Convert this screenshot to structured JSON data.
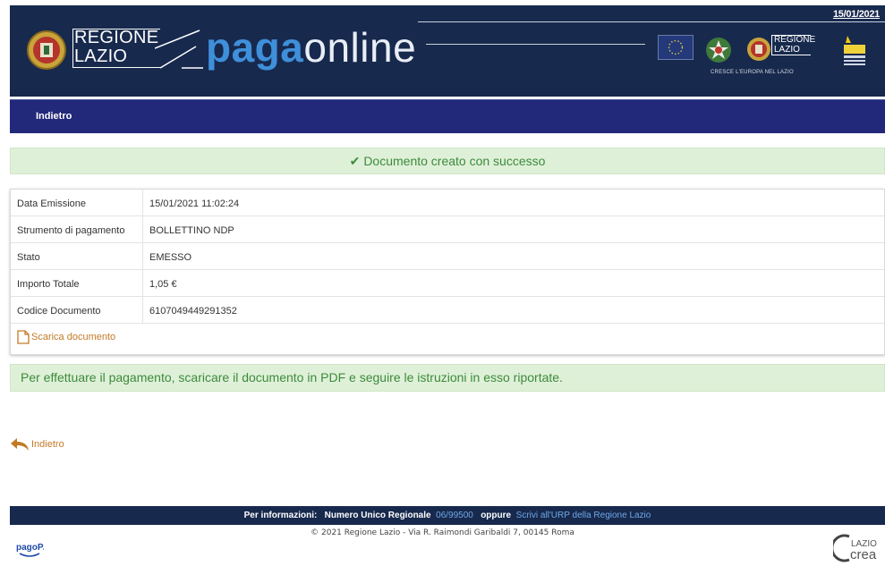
{
  "header": {
    "date": "15/01/2021",
    "regione_line1": "REGIONE",
    "regione_line2": "LAZIO",
    "brand_paga": "paga",
    "brand_online": "online",
    "small_regione_line1": "REGIONE",
    "small_regione_line2": "LAZIO",
    "cresce": "CRESCE L'EUROPA NEL LAZIO"
  },
  "nav": {
    "back_label": "Indietro"
  },
  "success_alert": {
    "icon": "checkmark-icon",
    "message": "Documento creato con successo"
  },
  "details": {
    "rows": [
      {
        "label": "Data Emissione",
        "value": "15/01/2021 11:02:24"
      },
      {
        "label": "Strumento di pagamento",
        "value": "BOLLETTINO NDP"
      },
      {
        "label": "Stato",
        "value": "EMESSO"
      },
      {
        "label": "Importo Totale",
        "value": "1,05 €"
      },
      {
        "label": "Codice Documento",
        "value": "6107049449291352"
      }
    ],
    "download_label": "Scarica documento",
    "download_icon": "document-icon"
  },
  "info_alert": {
    "message": "Per effettuare il pagamento, scaricare il documento in PDF e seguire le istruzioni in esso riportate."
  },
  "back_link": {
    "label": "Indietro",
    "icon": "back-arrow-icon"
  },
  "footer": {
    "info_prefix": "Per informazioni:",
    "numero_label": "Numero Unico Regionale",
    "numero_value": "06/99500",
    "oppure": "oppure",
    "urp_link": "Scrivi all'URP della Regione Lazio",
    "copyright": "© 2021 Regione Lazio - Via R. Raimondi Garibaldi 7, 00145 Roma",
    "pagopa": "pagoPA",
    "lazio_crea_line1": "LAZIO",
    "lazio_crea_line2": "crea"
  },
  "colors": {
    "header_bg": "#17294d",
    "nav_bg": "#22287a",
    "success_bg": "#dff0d8",
    "success_text": "#3c8b3c",
    "link_orange": "#c27a26"
  }
}
